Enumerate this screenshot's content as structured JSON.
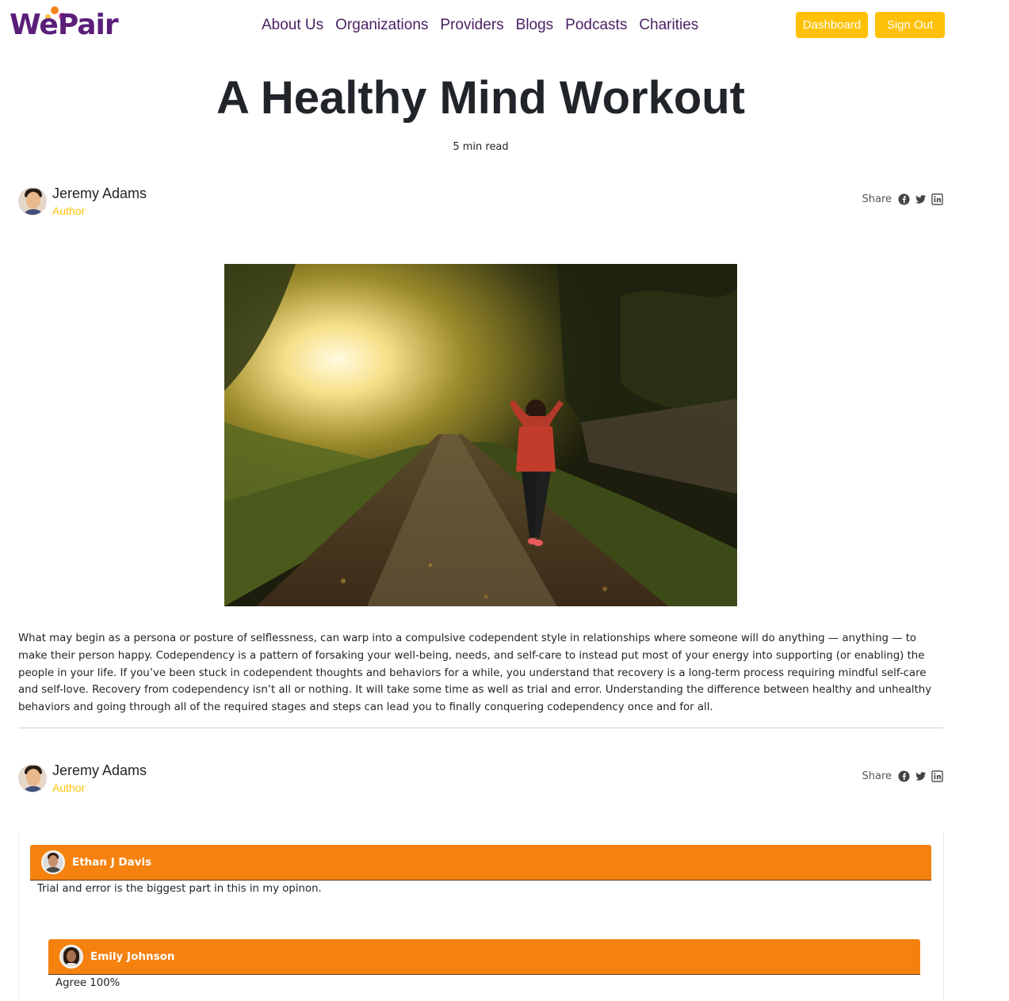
{
  "header": {
    "logo_text": "WePair",
    "nav": [
      "About Us",
      "Organizations",
      "Providers",
      "Blogs",
      "Podcasts",
      "Charities"
    ],
    "dashboard_label": "Dashboard",
    "signout_label": "Sign Out"
  },
  "article": {
    "title": "A Healthy Mind Workout",
    "read_time": "5 min read",
    "body": "What may begin as a persona or posture of selflessness, can warp into a compulsive codependent style in relationships where someone will do anything — anything — to make their person happy. Codependency is a pattern of forsaking your well-being, needs, and self-care to instead put most of your energy into supporting (or enabling) the people in your life. If you’ve been stuck in codependent thoughts and behaviors for a while, you understand that recovery is a long-term process requiring mindful self-care and self-love. Recovery from codependency isn’t all or nothing. It will take some time as well as trial and error. Understanding the difference between healthy and unhealthy behaviors and going through all of the required stages and steps can lead you to finally conquering codependency once and for all."
  },
  "author": {
    "name": "Jeremy Adams",
    "role": "Author"
  },
  "share": {
    "label": "Share",
    "icons": [
      "facebook-icon",
      "twitter-icon",
      "linkedin-icon"
    ]
  },
  "comments": [
    {
      "name": "Ethan J Davis",
      "text": "Trial and error is the biggest part in this in my opinon."
    },
    {
      "name": "Emily Johnson",
      "text": "Agree 100%"
    }
  ],
  "colors": {
    "brand_purple": "#5b1f7a",
    "accent_yellow": "#ffc107",
    "comment_orange": "#f5820f"
  }
}
